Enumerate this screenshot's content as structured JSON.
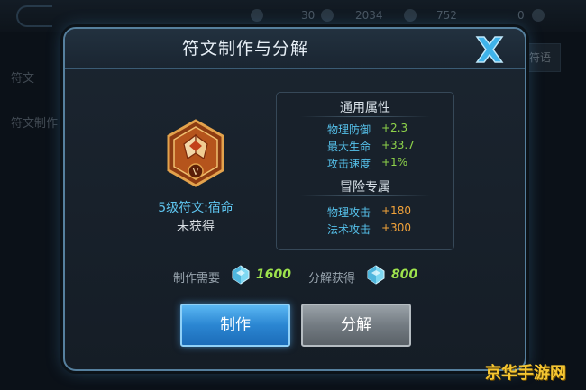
{
  "background": {
    "stats": [
      "30",
      "2034",
      "752",
      "0"
    ],
    "side_labels": [
      "符文",
      "符文制作"
    ],
    "right_button": "符语"
  },
  "dialog": {
    "title": "符文制作与分解",
    "rune": {
      "level_badge": "V",
      "name": "5级符文:宿命",
      "status": "未获得"
    },
    "general_section": {
      "title": "通用属性",
      "rows": [
        {
          "label": "物理防御",
          "value": "+2.3"
        },
        {
          "label": "最大生命",
          "value": "+33.7"
        },
        {
          "label": "攻击速度",
          "value": "+1%"
        }
      ]
    },
    "adventure_section": {
      "title": "冒险专属",
      "rows": [
        {
          "label": "物理攻击",
          "value": "+180"
        },
        {
          "label": "法术攻击",
          "value": "+300"
        }
      ]
    },
    "cost": {
      "make_label": "制作需要",
      "make_value": "1600",
      "decompose_label": "分解获得",
      "decompose_value": "800"
    },
    "buttons": {
      "make": "制作",
      "decompose": "分解"
    }
  },
  "watermark": "京华手游网",
  "colors": {
    "accent_blue": "#5fc6f0",
    "value_green": "#8ed34a",
    "value_orange": "#f1a23a",
    "button_blue": "#2b86d2"
  }
}
